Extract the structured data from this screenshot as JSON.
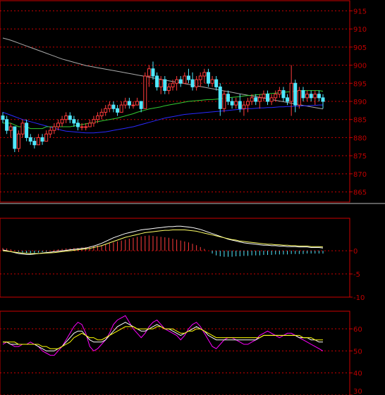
{
  "chart_data": [
    {
      "type": "candlestick",
      "panel": "price",
      "ylim": [
        862,
        918
      ],
      "yticks": [
        865,
        870,
        875,
        880,
        885,
        890,
        895,
        900,
        905,
        910,
        915
      ],
      "grid": true,
      "colors": {
        "up": "#ff3c3c",
        "down": "#50e8ff",
        "ma_short": "#33cc33",
        "ma_mid": "#2a2aff",
        "ma_long": "#aaaaaa",
        "grid": "#cc0000"
      },
      "candles": [
        [
          886,
          887,
          884,
          885
        ],
        [
          885,
          886,
          881,
          882
        ],
        [
          882,
          884,
          880,
          883
        ],
        [
          883,
          883,
          876,
          877
        ],
        [
          877,
          882,
          876,
          881
        ],
        [
          881,
          885,
          880,
          884
        ],
        [
          884,
          885,
          879,
          880
        ],
        [
          880,
          881,
          878,
          879
        ],
        [
          879,
          880,
          877,
          878
        ],
        [
          878,
          881,
          878,
          880
        ],
        [
          880,
          881,
          878,
          879
        ],
        [
          879,
          882,
          879,
          881
        ],
        [
          881,
          883,
          880,
          882
        ],
        [
          882,
          884,
          881,
          883
        ],
        [
          883,
          885,
          882,
          884
        ],
        [
          884,
          886,
          883,
          885
        ],
        [
          885,
          887,
          884,
          886
        ],
        [
          886,
          887,
          884,
          885
        ],
        [
          885,
          886,
          883,
          884
        ],
        [
          884,
          885,
          882,
          883
        ],
        [
          883,
          884,
          882,
          883
        ],
        [
          883,
          884,
          882,
          883
        ],
        [
          883,
          885,
          883,
          884
        ],
        [
          884,
          886,
          883,
          885
        ],
        [
          885,
          887,
          884,
          886
        ],
        [
          886,
          888,
          885,
          887
        ],
        [
          887,
          889,
          886,
          888
        ],
        [
          888,
          890,
          887,
          889
        ],
        [
          889,
          890,
          887,
          888
        ],
        [
          888,
          889,
          886,
          887
        ],
        [
          887,
          890,
          887,
          889
        ],
        [
          889,
          891,
          888,
          890
        ],
        [
          890,
          891,
          888,
          889
        ],
        [
          889,
          890,
          888,
          889
        ],
        [
          889,
          891,
          889,
          890
        ],
        [
          890,
          890,
          887,
          888
        ],
        [
          888,
          898,
          888,
          897
        ],
        [
          897,
          900,
          894,
          899
        ],
        [
          899,
          901,
          896,
          897
        ],
        [
          897,
          898,
          893,
          894
        ],
        [
          894,
          897,
          892,
          896
        ],
        [
          896,
          897,
          892,
          893
        ],
        [
          893,
          895,
          892,
          894
        ],
        [
          894,
          896,
          893,
          895
        ],
        [
          895,
          897,
          893,
          896
        ],
        [
          896,
          897,
          894,
          895
        ],
        [
          895,
          898,
          895,
          897
        ],
        [
          897,
          899,
          895,
          896
        ],
        [
          896,
          898,
          893,
          894
        ],
        [
          894,
          897,
          893,
          896
        ],
        [
          896,
          898,
          894,
          897
        ],
        [
          897,
          899,
          895,
          898
        ],
        [
          898,
          899,
          894,
          895
        ],
        [
          895,
          897,
          894,
          896
        ],
        [
          896,
          897,
          893,
          894
        ],
        [
          894,
          895,
          886,
          888
        ],
        [
          888,
          893,
          887,
          892
        ],
        [
          892,
          893,
          889,
          890
        ],
        [
          890,
          891,
          888,
          889
        ],
        [
          889,
          891,
          888,
          890
        ],
        [
          890,
          892,
          887,
          888
        ],
        [
          888,
          890,
          886,
          889
        ],
        [
          889,
          891,
          887,
          890
        ],
        [
          890,
          892,
          889,
          891
        ],
        [
          891,
          892,
          889,
          890
        ],
        [
          890,
          892,
          888,
          891
        ],
        [
          891,
          893,
          890,
          892
        ],
        [
          892,
          893,
          889,
          890
        ],
        [
          890,
          892,
          889,
          891
        ],
        [
          891,
          893,
          890,
          892
        ],
        [
          892,
          894,
          891,
          893
        ],
        [
          893,
          894,
          890,
          891
        ],
        [
          891,
          892,
          889,
          890
        ],
        [
          890,
          900,
          886,
          895
        ],
        [
          895,
          896,
          887,
          889
        ],
        [
          889,
          894,
          888,
          893
        ],
        [
          893,
          894,
          890,
          891
        ],
        [
          891,
          893,
          890,
          892
        ],
        [
          892,
          893,
          890,
          891
        ],
        [
          891,
          893,
          889,
          892
        ],
        [
          892,
          893,
          890,
          891
        ],
        [
          891,
          892,
          888,
          890
        ]
      ],
      "ma_short": [
        884,
        884,
        884,
        883.5,
        883,
        883,
        883,
        882.5,
        882.5,
        882.5,
        882.5,
        883,
        883,
        883,
        883,
        883,
        883,
        883,
        883.2,
        883.4,
        883.6,
        883.8,
        884,
        884.2,
        884.4,
        884.6,
        884.8,
        885,
        885.2,
        885.4,
        885.7,
        886,
        886.3,
        886.6,
        887,
        887.3,
        887.6,
        887.9,
        888.1,
        888.3,
        888.5,
        888.8,
        889,
        889.2,
        889.4,
        889.6,
        889.8,
        890,
        890.1,
        890.2,
        890.3,
        890.4,
        890.5,
        890.5,
        890.6,
        890.7,
        890.9,
        891,
        891.1,
        891.2,
        891.3,
        891.5,
        891.6,
        891.7,
        891.8,
        891.9,
        892,
        892.1,
        892.2,
        892.3,
        892.4,
        892.5,
        892.6,
        892.7,
        892.8,
        892.9,
        893,
        893,
        893,
        893,
        893,
        892.8
      ],
      "ma_mid": [
        887,
        886.6,
        886.2,
        885.8,
        885.4,
        885,
        884.7,
        884.4,
        884.1,
        883.8,
        883.5,
        883.2,
        882.9,
        882.6,
        882.3,
        882,
        881.8,
        881.7,
        881.6,
        881.5,
        881.4,
        881.3,
        881.3,
        881.3,
        881.4,
        881.5,
        881.6,
        881.8,
        882,
        882.2,
        882.4,
        882.6,
        882.8,
        883,
        883.3,
        883.6,
        883.9,
        884.2,
        884.5,
        884.8,
        885.1,
        885.4,
        885.6,
        885.8,
        886,
        886.2,
        886.4,
        886.5,
        886.6,
        886.7,
        886.8,
        886.9,
        887,
        887.1,
        887.2,
        887.3,
        887.4,
        887.5,
        887.6,
        887.7,
        887.8,
        887.9,
        888,
        888,
        888.1,
        888.2,
        888.2,
        888.3,
        888.3,
        888.4,
        888.5,
        888.5,
        888.6,
        888.6,
        888.7,
        888.7,
        888.8,
        888.8,
        888.9,
        888.9,
        889,
        889
      ],
      "ma_long": [
        907.5,
        907.2,
        906.9,
        906.5,
        906.1,
        905.7,
        905.3,
        904.9,
        904.5,
        904.1,
        903.7,
        903.3,
        902.9,
        902.5,
        902.1,
        901.7,
        901.4,
        901.1,
        900.8,
        900.5,
        900.2,
        899.9,
        899.7,
        899.5,
        899.3,
        899.1,
        898.9,
        898.7,
        898.5,
        898.3,
        898.1,
        897.9,
        897.7,
        897.5,
        897.3,
        897.1,
        896.9,
        896.7,
        896.5,
        896.3,
        896.1,
        895.9,
        895.7,
        895.5,
        895.3,
        895.1,
        894.9,
        894.7,
        894.5,
        894.3,
        894.1,
        893.9,
        893.7,
        893.5,
        893.3,
        893.1,
        892.9,
        892.7,
        892.5,
        892.3,
        892.1,
        891.9,
        891.7,
        891.5,
        891.3,
        891.1,
        890.9,
        890.7,
        890.5,
        890.3,
        890.1,
        889.9,
        889.7,
        889.5,
        889.3,
        889.1,
        888.9,
        888.7,
        888.5,
        888.3,
        888.1,
        887.9
      ]
    },
    {
      "type": "macd",
      "panel": "macd",
      "ylim": [
        -10,
        7
      ],
      "yticks": [
        0,
        -5,
        -10
      ],
      "grid": true,
      "histogram": [
        0.6,
        0.5,
        0.3,
        0.1,
        -0.2,
        -0.4,
        -0.5,
        -0.6,
        -0.5,
        -0.4,
        -0.3,
        -0.2,
        0,
        0.2,
        0.3,
        0.4,
        0.5,
        0.5,
        0.6,
        0.6,
        0.7,
        0.8,
        0.9,
        1.0,
        1.1,
        1.2,
        1.4,
        1.6,
        1.8,
        2.0,
        2.2,
        2.4,
        2.6,
        2.8,
        3.0,
        3.1,
        3.2,
        3.3,
        3.2,
        3.1,
        3.0,
        2.9,
        2.8,
        2.6,
        2.4,
        2.2,
        2.0,
        1.8,
        1.5,
        1.2,
        0.8,
        0.4,
        0,
        -0.6,
        -1.0,
        -1.2,
        -1.3,
        -1.3,
        -1.3,
        -1.2,
        -1.2,
        -1.1,
        -1.1,
        -1.0,
        -1.0,
        -1.0,
        -0.9,
        -0.9,
        -0.9,
        -0.8,
        -0.8,
        -0.8,
        -0.8,
        -0.7,
        -0.7,
        -0.7,
        -0.7,
        -0.6,
        -0.6,
        -0.6,
        -0.6,
        -0.6
      ],
      "dif": [
        0.2,
        0,
        -0.2,
        -0.4,
        -0.6,
        -0.7,
        -0.8,
        -0.8,
        -0.7,
        -0.6,
        -0.5,
        -0.4,
        -0.3,
        -0.2,
        -0.1,
        0,
        0.1,
        0.2,
        0.3,
        0.4,
        0.5,
        0.6,
        0.8,
        1.0,
        1.3,
        1.6,
        2.0,
        2.4,
        2.8,
        3.1,
        3.4,
        3.7,
        3.9,
        4.1,
        4.3,
        4.5,
        4.6,
        4.7,
        4.8,
        4.9,
        5.0,
        5.1,
        5.2,
        5.2,
        5.3,
        5.3,
        5.2,
        5.1,
        5.0,
        4.8,
        4.6,
        4.3,
        4.0,
        3.7,
        3.4,
        3.1,
        2.8,
        2.5,
        2.3,
        2.1,
        1.9,
        1.7,
        1.6,
        1.5,
        1.4,
        1.3,
        1.2,
        1.2,
        1.1,
        1.1,
        1.0,
        1.0,
        0.9,
        0.9,
        0.9,
        0.8,
        0.8,
        0.8,
        0.7,
        0.7,
        0.7,
        0.6
      ],
      "dea": [
        0,
        -0.1,
        -0.2,
        -0.3,
        -0.4,
        -0.5,
        -0.55,
        -0.6,
        -0.6,
        -0.6,
        -0.55,
        -0.5,
        -0.45,
        -0.4,
        -0.3,
        -0.2,
        -0.1,
        0,
        0.1,
        0.2,
        0.3,
        0.4,
        0.5,
        0.7,
        0.9,
        1.1,
        1.4,
        1.7,
        2.0,
        2.3,
        2.6,
        2.9,
        3.1,
        3.3,
        3.5,
        3.7,
        3.9,
        4.0,
        4.1,
        4.2,
        4.3,
        4.4,
        4.4,
        4.5,
        4.5,
        4.5,
        4.5,
        4.4,
        4.3,
        4.2,
        4.0,
        3.8,
        3.6,
        3.4,
        3.2,
        3.0,
        2.8,
        2.6,
        2.4,
        2.3,
        2.1,
        2.0,
        1.9,
        1.8,
        1.7,
        1.6,
        1.5,
        1.4,
        1.4,
        1.3,
        1.3,
        1.2,
        1.2,
        1.1,
        1.1,
        1.0,
        1.0,
        1.0,
        0.9,
        0.9,
        0.9,
        0.8
      ]
    },
    {
      "type": "line",
      "panel": "oscillator",
      "ylim": [
        30,
        68
      ],
      "yticks": [
        60,
        50,
        40,
        30
      ],
      "grid": true,
      "series": [
        {
          "color": "#ff00ff",
          "values": [
            53,
            54,
            53,
            52,
            52,
            53,
            53,
            54,
            53,
            52,
            50,
            49,
            48,
            48,
            50,
            52,
            55,
            58,
            61,
            63,
            62,
            58,
            52,
            50,
            51,
            53,
            55,
            58,
            62,
            64,
            65,
            66,
            63,
            60,
            58,
            56,
            58,
            61,
            63,
            64,
            62,
            60,
            59,
            58,
            57,
            55,
            57,
            60,
            62,
            63,
            61,
            58,
            55,
            52,
            51,
            53,
            55,
            56,
            56,
            55,
            54,
            53,
            53,
            54,
            55,
            57,
            58,
            59,
            58,
            57,
            56,
            57,
            58,
            58,
            57,
            56,
            55,
            54,
            53,
            52,
            51,
            50
          ]
        },
        {
          "color": "#ffffff",
          "values": [
            54,
            54,
            53,
            53,
            53,
            53,
            53,
            53,
            53,
            52,
            51,
            50,
            50,
            50,
            51,
            52,
            54,
            56,
            58,
            59,
            59,
            57,
            55,
            54,
            54,
            54,
            55,
            57,
            59,
            61,
            62,
            63,
            62,
            61,
            60,
            59,
            59,
            60,
            61,
            62,
            61,
            60,
            60,
            59,
            58,
            57,
            58,
            59,
            60,
            61,
            60,
            59,
            57,
            56,
            55,
            55,
            55,
            55,
            55,
            55,
            55,
            55,
            55,
            55,
            55,
            56,
            57,
            57,
            57,
            57,
            57,
            57,
            57,
            57,
            57,
            56,
            56,
            56,
            55,
            55,
            54,
            54
          ]
        },
        {
          "color": "#ffff00",
          "values": [
            54,
            54,
            54,
            54,
            53,
            53,
            53,
            53,
            53,
            53,
            52,
            52,
            51,
            51,
            51,
            52,
            53,
            54,
            56,
            57,
            58,
            57,
            56,
            56,
            55,
            55,
            56,
            57,
            58,
            59,
            60,
            61,
            61,
            61,
            60,
            60,
            60,
            60,
            60,
            61,
            61,
            60,
            60,
            60,
            59,
            58,
            58,
            59,
            59,
            60,
            60,
            59,
            58,
            57,
            56,
            56,
            56,
            56,
            56,
            56,
            56,
            56,
            56,
            56,
            56,
            56,
            57,
            57,
            57,
            57,
            57,
            57,
            57,
            57,
            57,
            57,
            56,
            56,
            56,
            55,
            55,
            55
          ]
        }
      ]
    }
  ]
}
